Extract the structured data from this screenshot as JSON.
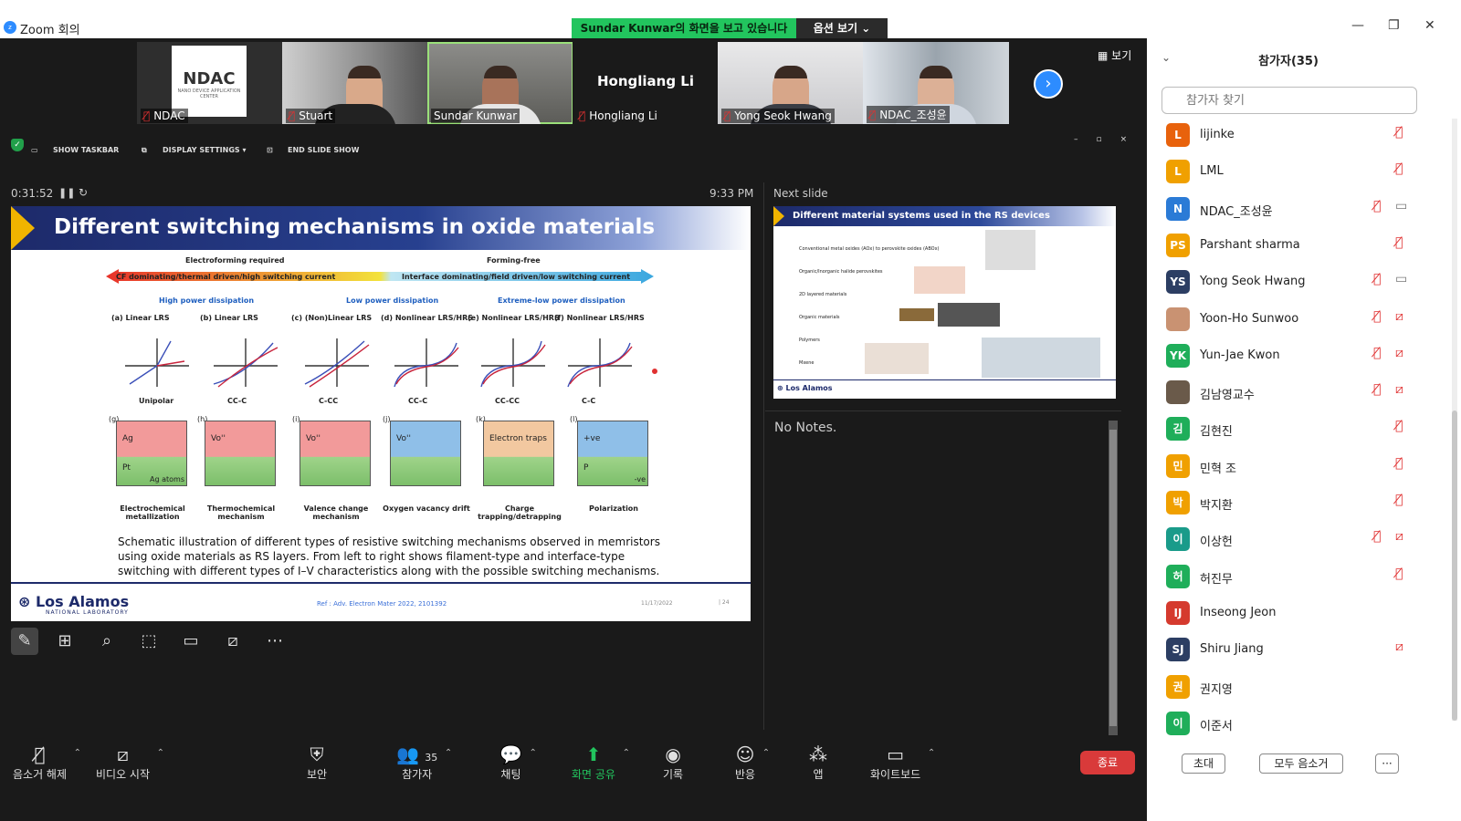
{
  "app": {
    "title": "Zoom 회의",
    "logo": "zoom"
  },
  "banner": {
    "text": "Sundar  Kunwar의 화면을 보고 있습니다",
    "options": "옵션 보기 ⌄"
  },
  "view_button": "▦ 보기",
  "tiles": [
    {
      "name": "NDAC",
      "muted": true,
      "logo_text": "NDAC",
      "logo_sub": "NANO DEVICE APPLICATION CENTER"
    },
    {
      "name": "Stuart",
      "muted": true
    },
    {
      "name": "Sundar Kunwar",
      "muted": false,
      "active": true
    },
    {
      "name": "Hongliang Li",
      "muted": true,
      "big_name": "Hongliang Li"
    },
    {
      "name": "Yong Seok Hwang",
      "muted": true
    },
    {
      "name": "NDAC_조성윤",
      "muted": true
    }
  ],
  "slideshow_bar": {
    "show_taskbar": "SHOW TASKBAR",
    "display_settings": "DISPLAY SETTINGS ▾",
    "end_slide_show": "END SLIDE SHOW"
  },
  "presenter": {
    "timer": "0:31:52",
    "clock": "9:33 PM",
    "next_slide_label": "Next slide",
    "notes": "No Notes."
  },
  "slide": {
    "title": "Different switching mechanisms in oxide materials",
    "electroforming": "Electroforming required",
    "forming_free": "Forming-free",
    "cf_text": "CF dominating/thermal driven/high switching current",
    "if_text": "Interface dominating/field driven/low switching current",
    "high_power": "High power dissipation",
    "low_power": "Low power dissipation",
    "extreme_low": "Extreme-low power dissipation",
    "plots": [
      {
        "label": "(a)",
        "title": "Linear LRS",
        "mode": "Unipolar"
      },
      {
        "label": "(b)",
        "title": "Linear LRS",
        "mode": "CC-C"
      },
      {
        "label": "(c)",
        "title": "(Non)Linear LRS",
        "mode": "C-CC"
      },
      {
        "label": "(d)",
        "title": "Nonlinear LRS/HRS",
        "mode": "CC-C"
      },
      {
        "label": "(e)",
        "title": "Nonlinear LRS/HRS",
        "mode": "CC-CC"
      },
      {
        "label": "(f)",
        "title": "Nonlinear LRS/HRS",
        "mode": "C-C"
      }
    ],
    "mechanisms": [
      {
        "label": "(g)",
        "name": "Electrochemical metallization",
        "inside": "Ag",
        "inside2": "Pt",
        "inside3": "Ag atoms"
      },
      {
        "label": "(h)",
        "name": "Thermochemical mechanism",
        "inside": "Vo''"
      },
      {
        "label": "(i)",
        "name": "Valence change mechanism",
        "inside": "Vo''"
      },
      {
        "label": "(j)",
        "name": "Oxygen vacancy drift",
        "inside": "Vo''"
      },
      {
        "label": "(k)",
        "name": "Charge trapping/detrapping",
        "inside": "Electron traps"
      },
      {
        "label": "(l)",
        "name": "Polarization",
        "inside": "+ve",
        "inside2": "P",
        "inside3": "-ve"
      }
    ],
    "caption": "Schematic illustration of different types of resistive switching mechanisms observed in memristors using oxide materials as RS layers. From left to right shows filament-type and interface-type switching with different types of I–V characteristics along with the possible switching mechanisms.",
    "footer_logo": "Los Alamos",
    "footer_logo_sub": "NATIONAL LABORATORY",
    "ref": "Ref : Adv. Electron Mater 2022, 2101392",
    "date": "11/17/2022",
    "page": "| 24"
  },
  "next_slide": {
    "title": "Different material systems used in the RS devices",
    "bullets": [
      "Conventional metal oxides (AOx) to perovskite oxides (ABOx)",
      "Organic/Inorganic halide perovskites",
      "2D layered materials",
      "Organic materials",
      "Polymers",
      "Mxene"
    ],
    "footer_logo": "Los Alamos"
  },
  "toolbar": {
    "mute": "음소거 해제",
    "video": "비디오 시작",
    "security": "보안",
    "participants": "참가자",
    "participants_count": "35",
    "chat": "채팅",
    "share": "화면 공유",
    "record": "기록",
    "reactions": "반응",
    "apps": "앱",
    "whiteboard": "화이트보드",
    "end": "종료"
  },
  "panel": {
    "title": "참가자(35)",
    "search_placeholder": "참가자 찾기",
    "invite": "초대",
    "mute_all": "모두 음소거",
    "more": "···",
    "participants": [
      {
        "initial": "L",
        "name": "lijinke",
        "color": "#e8620c",
        "mic": "muted",
        "video": ""
      },
      {
        "initial": "L",
        "name": "LML",
        "color": "#f0a000",
        "mic": "muted",
        "video": ""
      },
      {
        "initial": "N",
        "name": "NDAC_조성윤",
        "color": "#2b7bd6",
        "mic": "muted",
        "video": "on"
      },
      {
        "initial": "PS",
        "name": "Parshant sharma",
        "color": "#f0a000",
        "mic": "muted",
        "video": ""
      },
      {
        "initial": "YS",
        "name": "Yong Seok Hwang",
        "color": "#2c3e63",
        "mic": "muted",
        "video": "on"
      },
      {
        "initial": "",
        "name": "Yoon-Ho Sunwoo",
        "color": "#c99272",
        "mic": "muted",
        "video": "off"
      },
      {
        "initial": "YK",
        "name": "Yun-Jae Kwon",
        "color": "#1fae5a",
        "mic": "muted",
        "video": "off"
      },
      {
        "initial": "",
        "name": "김남영교수",
        "color": "#6a5a4a",
        "mic": "muted",
        "video": "off"
      },
      {
        "initial": "김",
        "name": "김현진",
        "color": "#1fae5a",
        "mic": "muted",
        "video": ""
      },
      {
        "initial": "민",
        "name": "민혁 조",
        "color": "#f0a000",
        "mic": "muted",
        "video": ""
      },
      {
        "initial": "박",
        "name": "박지환",
        "color": "#f0a000",
        "mic": "muted",
        "video": ""
      },
      {
        "initial": "이",
        "name": "이상헌",
        "color": "#1a9b8a",
        "mic": "muted",
        "video": "off"
      },
      {
        "initial": "허",
        "name": "허진무",
        "color": "#1fae5a",
        "mic": "muted",
        "video": ""
      },
      {
        "initial": "IJ",
        "name": "Inseong Jeon",
        "color": "#d53a2e",
        "mic": "",
        "video": ""
      },
      {
        "initial": "SJ",
        "name": "Shiru Jiang",
        "color": "#2c3e63",
        "mic": "",
        "video": "off"
      },
      {
        "initial": "권",
        "name": "권지영",
        "color": "#f0a000",
        "mic": "",
        "video": ""
      },
      {
        "initial": "이",
        "name": "이준서",
        "color": "#1fae5a",
        "mic": "",
        "video": ""
      }
    ]
  }
}
